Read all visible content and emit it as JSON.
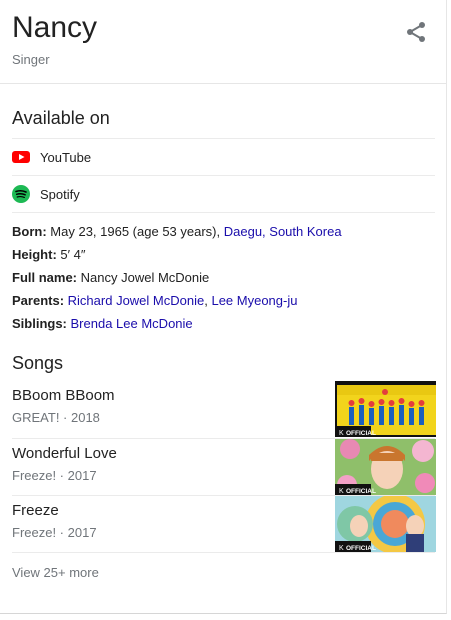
{
  "header": {
    "title": "Nancy",
    "subtitle": "Singer"
  },
  "available": {
    "heading": "Available on",
    "platforms": [
      {
        "label": "YouTube",
        "icon": "youtube-icon"
      },
      {
        "label": "Spotify",
        "icon": "spotify-icon"
      }
    ]
  },
  "facts": {
    "born": {
      "label": "Born:",
      "text": "May 23, 1965 (age 53 years),",
      "place": "Daegu, South Korea"
    },
    "height": {
      "label": "Height:",
      "text": "5′ 4″"
    },
    "full_name": {
      "label": "Full name:",
      "text": "Nancy Jowel McDonie"
    },
    "parents": {
      "label": "Parents:",
      "p1": "Richard Jowel McDonie",
      "sep": ",",
      "p2": "Lee Myeong-ju"
    },
    "siblings": {
      "label": "Siblings:",
      "s1": "Brenda Lee McDonie"
    }
  },
  "songs": {
    "heading": "Songs",
    "items": [
      {
        "title": "BBoom BBoom",
        "subtitle": "GREAT! · 2018",
        "badge": "OFFICIAL"
      },
      {
        "title": "Wonderful Love",
        "subtitle": "Freeze! · 2017",
        "badge": "OFFICIAL"
      },
      {
        "title": "Freeze",
        "subtitle": "Freeze! · 2017",
        "badge": "OFFICIAL"
      }
    ],
    "more": "View 25+ more"
  },
  "colors": {
    "link": "#1a0dab",
    "youtube": "#ff0000",
    "spotify": "#1db954",
    "muted": "#70757a"
  }
}
